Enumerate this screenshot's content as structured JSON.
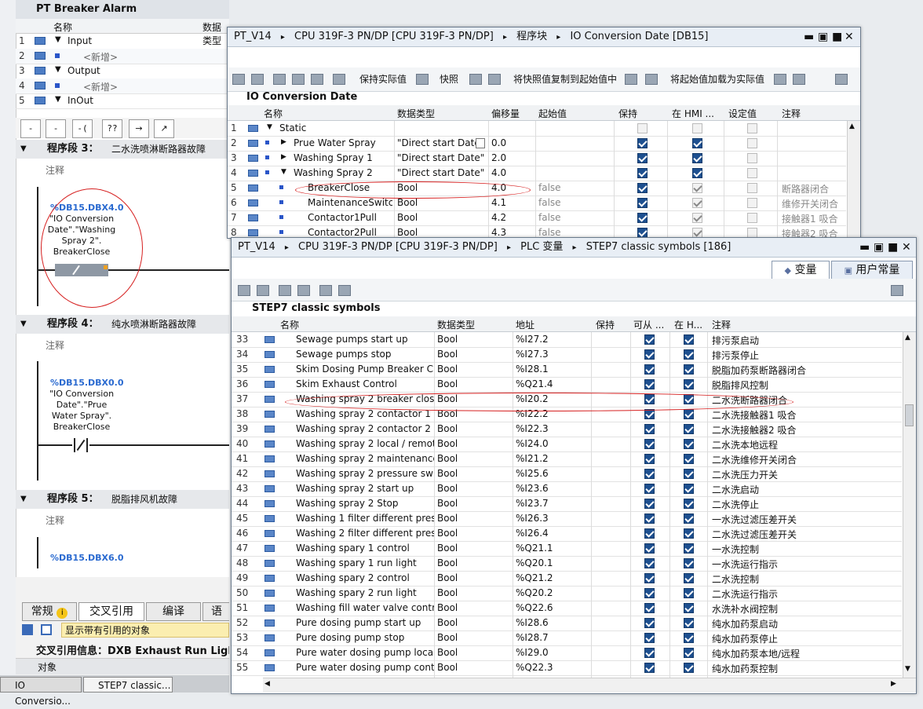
{
  "left": {
    "title": "PT Breaker Alarm",
    "col_name": "名称",
    "col_type": "数据类型",
    "interface": [
      {
        "num": "1",
        "label": "Input",
        "kind": "group"
      },
      {
        "num": "2",
        "label": "<新增>",
        "kind": "new"
      },
      {
        "num": "3",
        "label": "Output",
        "kind": "group"
      },
      {
        "num": "4",
        "label": "<新增>",
        "kind": "new"
      },
      {
        "num": "5",
        "label": "InOut",
        "kind": "group"
      }
    ],
    "ladder_buttons": [
      "-||-",
      "-|/|-",
      "-( )-",
      "??",
      "→",
      "↗"
    ],
    "networks": [
      {
        "title": "程序段 3：",
        "desc": "二水洗喷淋断路器故障",
        "comment": "注释",
        "operand": "%DB15.DBX4.0",
        "name_lines": [
          "\"IO Conversion",
          "Date\".\"Washing",
          "Spray 2\".",
          "BreakerClose"
        ]
      },
      {
        "title": "程序段 4：",
        "desc": "纯水喷淋断路器故障",
        "comment": "注释",
        "operand": "%DB15.DBX0.0",
        "name_lines": [
          "\"IO Conversion",
          "Date\".\"Prue",
          "Water Spray\".",
          "BreakerClose"
        ]
      },
      {
        "title": "程序段 5：",
        "desc": "脱脂排风机故障",
        "comment": "注释",
        "operand": "%DB15.DBX6.0",
        "name_lines": []
      }
    ],
    "bottom_tabs": [
      "常规",
      "交叉引用",
      "编译",
      "语"
    ],
    "show_refs": "显示带有引用的对象",
    "xref_info": "交叉引用信息：DXB Exhaust Run Ligh",
    "object_label": "对象"
  },
  "taskbar": [
    "IO Conversio...",
    "STEP7 classic..."
  ],
  "db_window": {
    "title_parts": [
      "PT_V14",
      "CPU 319F-3 PN/DP [CPU 319F-3 PN/DP]",
      "程序块",
      "IO Conversion Date [DB15]"
    ],
    "toolbar": {
      "keep_actual": "保持实际值",
      "snapshot": "快照",
      "copy_snapshot": "将快照值复制到起始值中",
      "load_start": "将起始值加载为实际值"
    },
    "section_title": "IO Conversion Date",
    "columns": [
      "名称",
      "数据类型",
      "偏移量",
      "起始值",
      "保持",
      "在 HMI ...",
      "设定值",
      "注释"
    ],
    "rows": [
      {
        "n": "1",
        "name": "Static",
        "type": "",
        "offset": "",
        "start": "",
        "retain": null,
        "hmi": null,
        "set": false,
        "comment": "",
        "level": 0,
        "expand": "down",
        "icon": true
      },
      {
        "n": "2",
        "name": "Prue Water Spray",
        "type": "\"Direct start Date\"",
        "offset": "0.0",
        "start": "",
        "retain": true,
        "hmi": true,
        "set": false,
        "comment": "",
        "level": 1,
        "expand": "right",
        "icon": true
      },
      {
        "n": "3",
        "name": "Washing Spray 1",
        "type": "\"Direct start Date\"",
        "offset": "2.0",
        "start": "",
        "retain": true,
        "hmi": true,
        "set": false,
        "comment": "",
        "level": 1,
        "expand": "right",
        "icon": true
      },
      {
        "n": "4",
        "name": "Washing Spray 2",
        "type": "\"Direct start Date\"",
        "offset": "4.0",
        "start": "",
        "retain": true,
        "hmi": true,
        "set": false,
        "comment": "",
        "level": 1,
        "expand": "down",
        "icon": true
      },
      {
        "n": "5",
        "name": "BreakerClose",
        "type": "Bool",
        "offset": "4.0",
        "start": "false",
        "retain": true,
        "hmi": true,
        "set": false,
        "comment": "断路器闭合",
        "level": 2,
        "expand": "",
        "icon": true
      },
      {
        "n": "6",
        "name": "MaintenanceSwitc...",
        "type": "Bool",
        "offset": "4.1",
        "start": "false",
        "retain": true,
        "hmi": true,
        "set": false,
        "comment": "维修开关闭合",
        "level": 2,
        "expand": "",
        "icon": true
      },
      {
        "n": "7",
        "name": "Contactor1Pull",
        "type": "Bool",
        "offset": "4.2",
        "start": "false",
        "retain": true,
        "hmi": true,
        "set": false,
        "comment": "接触器1 吸合",
        "level": 2,
        "expand": "",
        "icon": true
      },
      {
        "n": "8",
        "name": "Contactor2Pull",
        "type": "Bool",
        "offset": "4.3",
        "start": "false",
        "retain": true,
        "hmi": true,
        "set": false,
        "comment": "接触器2 吸合",
        "level": 2,
        "expand": "",
        "icon": true
      }
    ]
  },
  "tag_window": {
    "title_parts": [
      "PT_V14",
      "CPU 319F-3 PN/DP [CPU 319F-3 PN/DP]",
      "PLC 变量",
      "STEP7 classic symbols [186]"
    ],
    "tabs": [
      "变量",
      "用户常量"
    ],
    "section_title": "STEP7 classic symbols",
    "columns": [
      "名称",
      "数据类型",
      "地址",
      "保持",
      "可从 ...",
      "在 H...",
      "注释"
    ],
    "rows": [
      {
        "n": "33",
        "name": "Sewage pumps start up",
        "type": "Bool",
        "addr": "%I27.2",
        "comment": "排污泵启动"
      },
      {
        "n": "34",
        "name": "Sewage pumps stop",
        "type": "Bool",
        "addr": "%I27.3",
        "comment": "排污泵停止"
      },
      {
        "n": "35",
        "name": "Skim Dosing Pump Breaker Close",
        "type": "Bool",
        "addr": "%I28.1",
        "comment": "脱脂加药泵断路器闭合"
      },
      {
        "n": "36",
        "name": "Skim Exhaust Control",
        "type": "Bool",
        "addr": "%Q21.4",
        "comment": "脱脂排风控制"
      },
      {
        "n": "37",
        "name": "Washing spray 2 breaker close",
        "type": "Bool",
        "addr": "%I20.2",
        "comment": "二水洗断路器闭合"
      },
      {
        "n": "38",
        "name": "Washing spray 2 contactor 1 pull",
        "type": "Bool",
        "addr": "%I22.2",
        "comment": "二水洗接触器1 吸合"
      },
      {
        "n": "39",
        "name": "Washing spray 2 contactor 2 pull",
        "type": "Bool",
        "addr": "%I22.3",
        "comment": "二水洗接触器2 吸合"
      },
      {
        "n": "40",
        "name": "Washing spray 2 local / remote",
        "type": "Bool",
        "addr": "%I24.0",
        "comment": "二水洗本地远程"
      },
      {
        "n": "41",
        "name": "Washing spray 2 maintenance ...",
        "type": "Bool",
        "addr": "%I21.2",
        "comment": "二水洗维修开关闭合"
      },
      {
        "n": "42",
        "name": "Washing spray 2 pressure switch",
        "type": "Bool",
        "addr": "%I25.6",
        "comment": "二水洗压力开关"
      },
      {
        "n": "43",
        "name": "Washing spray 2 start up",
        "type": "Bool",
        "addr": "%I23.6",
        "comment": "二水洗启动"
      },
      {
        "n": "44",
        "name": "Washing spray 2 Stop",
        "type": "Bool",
        "addr": "%I23.7",
        "comment": "二水洗停止"
      },
      {
        "n": "45",
        "name": "Washing 1 filter different press...",
        "type": "Bool",
        "addr": "%I26.3",
        "comment": "一水洗过滤压差开关"
      },
      {
        "n": "46",
        "name": "Washing 2 filter different press...",
        "type": "Bool",
        "addr": "%I26.4",
        "comment": "二水洗过滤压差开关"
      },
      {
        "n": "47",
        "name": "Washing spary 1 control",
        "type": "Bool",
        "addr": "%Q21.1",
        "comment": "一水洗控制"
      },
      {
        "n": "48",
        "name": "Washing spary 1 run light",
        "type": "Bool",
        "addr": "%Q20.1",
        "comment": "一水洗运行指示"
      },
      {
        "n": "49",
        "name": "Washing spary 2 control",
        "type": "Bool",
        "addr": "%Q21.2",
        "comment": "二水洗控制"
      },
      {
        "n": "50",
        "name": "Washing spary 2 run light",
        "type": "Bool",
        "addr": "%Q20.2",
        "comment": "二水洗运行指示"
      },
      {
        "n": "51",
        "name": "Washing fill water valve control",
        "type": "Bool",
        "addr": "%Q22.6",
        "comment": "水洗补水阀控制"
      },
      {
        "n": "52",
        "name": "Pure dosing pump start up",
        "type": "Bool",
        "addr": "%I28.6",
        "comment": "纯水加药泵启动"
      },
      {
        "n": "53",
        "name": "Pure dosing pump stop",
        "type": "Bool",
        "addr": "%I28.7",
        "comment": "纯水加药泵停止"
      },
      {
        "n": "54",
        "name": "Pure water dosing pump local /...",
        "type": "Bool",
        "addr": "%I29.0",
        "comment": "纯水加药泵本地/远程"
      },
      {
        "n": "55",
        "name": "Pure water dosing pump control",
        "type": "Bool",
        "addr": "%Q22.3",
        "comment": "纯水加药泵控制"
      }
    ]
  },
  "colors": {
    "accent": "#1d4f8f",
    "operand": "#2a6ad0",
    "annotation": "#d62020"
  }
}
